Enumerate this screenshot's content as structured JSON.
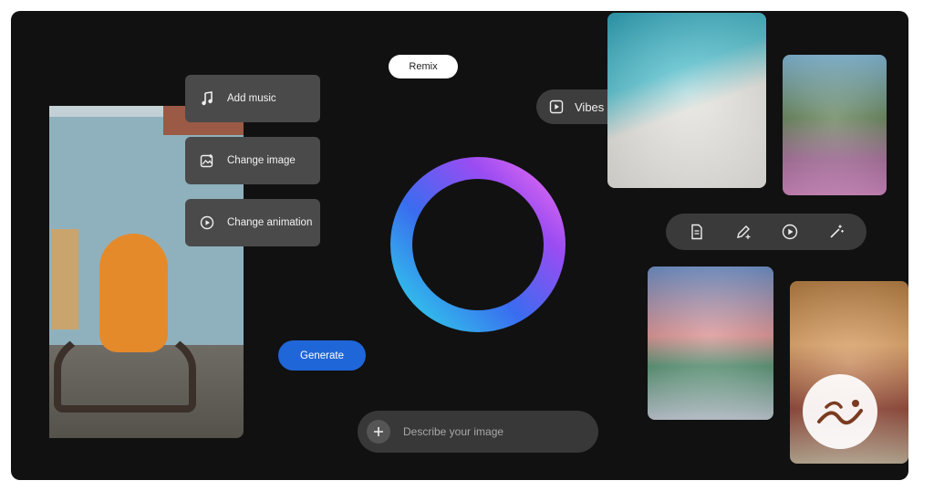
{
  "remix": {
    "label": "Remix"
  },
  "side_menu": {
    "items": [
      {
        "label": "Add music",
        "icon": "music-note-icon"
      },
      {
        "label": "Change image",
        "icon": "image-edit-icon"
      },
      {
        "label": "Change animation",
        "icon": "play-circle-icon"
      }
    ]
  },
  "vibes": {
    "label": "Vibes",
    "icon": "play-square-icon"
  },
  "generate": {
    "label": "Generate"
  },
  "prompt": {
    "placeholder": "Describe your image",
    "value": "",
    "add_icon": "plus-icon"
  },
  "toolbar": {
    "items": [
      {
        "icon": "document-icon"
      },
      {
        "icon": "pencil-sparkle-icon"
      },
      {
        "icon": "play-circle-icon"
      },
      {
        "icon": "magic-wand-icon"
      }
    ]
  },
  "images": [
    {
      "name": "orange-monster-motorbike"
    },
    {
      "name": "cat-bathrobe-pool"
    },
    {
      "name": "moose-jumping-pool"
    },
    {
      "name": "van-landscape-sunset"
    },
    {
      "name": "dancers-desert"
    }
  ],
  "colors": {
    "background": "#111111",
    "accent_blue": "#1f66d9",
    "ring_gradient": [
      "#2fd1e8",
      "#3a6cf0",
      "#9b4cf2",
      "#e46cf0"
    ]
  },
  "logo": {
    "icon": "watermark-logo-icon"
  }
}
